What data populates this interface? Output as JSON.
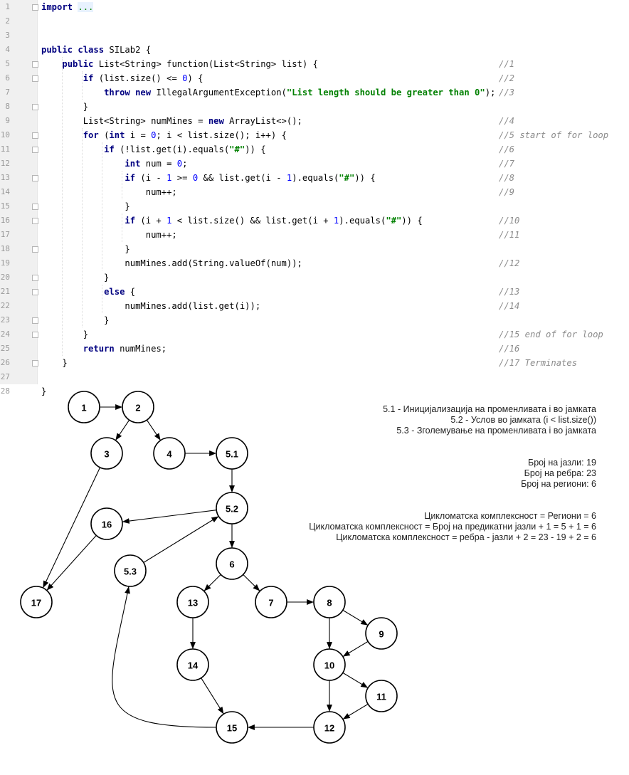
{
  "code": {
    "lines": [
      {
        "n": "1",
        "fold": true,
        "parts": [
          [
            "kw",
            "import "
          ],
          [
            "fold-text",
            "..."
          ]
        ],
        "comment": ""
      },
      {
        "n": "2",
        "fold": false,
        "parts": [],
        "comment": ""
      },
      {
        "n": "3",
        "fold": false,
        "parts": [],
        "comment": ""
      },
      {
        "n": "4",
        "fold": false,
        "parts": [
          [
            "kw",
            "public class "
          ],
          [
            "",
            "SILab2 {"
          ]
        ],
        "comment": ""
      },
      {
        "n": "5",
        "fold": true,
        "parts": [
          [
            "",
            "    "
          ],
          [
            "kw",
            "public "
          ],
          [
            "",
            "List<String> function(List<String> list) {"
          ]
        ],
        "comment": "//1"
      },
      {
        "n": "6",
        "fold": true,
        "parts": [
          [
            "",
            "        "
          ],
          [
            "kw",
            "if "
          ],
          [
            "",
            "(list.size() <= "
          ],
          [
            "num",
            "0"
          ],
          [
            "",
            ") {"
          ]
        ],
        "comment": "//2"
      },
      {
        "n": "7",
        "fold": false,
        "parts": [
          [
            "",
            "            "
          ],
          [
            "kw",
            "throw new "
          ],
          [
            "",
            "IllegalArgumentException("
          ],
          [
            "str",
            "\"List length should be greater than 0\""
          ],
          [
            "",
            ");"
          ]
        ],
        "comment": "//3"
      },
      {
        "n": "8",
        "fold": true,
        "parts": [
          [
            "",
            "        }"
          ]
        ],
        "comment": ""
      },
      {
        "n": "9",
        "fold": false,
        "parts": [
          [
            "",
            "        List<String> numMines = "
          ],
          [
            "kw",
            "new "
          ],
          [
            "",
            "ArrayList<>();"
          ]
        ],
        "comment": "//4"
      },
      {
        "n": "10",
        "fold": true,
        "parts": [
          [
            "",
            "        "
          ],
          [
            "kw",
            "for "
          ],
          [
            "",
            "("
          ],
          [
            "kw",
            "int "
          ],
          [
            "",
            "i = "
          ],
          [
            "num",
            "0"
          ],
          [
            "",
            "; i < list.size(); i++) {"
          ]
        ],
        "comment": "//5 start of for loop"
      },
      {
        "n": "11",
        "fold": true,
        "parts": [
          [
            "",
            "            "
          ],
          [
            "kw",
            "if "
          ],
          [
            "",
            "(!list.get(i).equals("
          ],
          [
            "str",
            "\"#\""
          ],
          [
            "",
            ")) {"
          ]
        ],
        "comment": "//6"
      },
      {
        "n": "12",
        "fold": false,
        "parts": [
          [
            "",
            "                "
          ],
          [
            "kw",
            "int "
          ],
          [
            "",
            "num = "
          ],
          [
            "num",
            "0"
          ],
          [
            "",
            ";"
          ]
        ],
        "comment": "//7"
      },
      {
        "n": "13",
        "fold": true,
        "parts": [
          [
            "",
            "                "
          ],
          [
            "kw",
            "if "
          ],
          [
            "",
            "(i - "
          ],
          [
            "num",
            "1"
          ],
          [
            "",
            " >= "
          ],
          [
            "num",
            "0"
          ],
          [
            "",
            " && list.get(i - "
          ],
          [
            "num",
            "1"
          ],
          [
            "",
            ").equals("
          ],
          [
            "str",
            "\"#\""
          ],
          [
            "",
            ")) {"
          ]
        ],
        "comment": "//8"
      },
      {
        "n": "14",
        "fold": false,
        "parts": [
          [
            "",
            "                    num++;"
          ]
        ],
        "comment": "//9"
      },
      {
        "n": "15",
        "fold": true,
        "parts": [
          [
            "",
            "                }"
          ]
        ],
        "comment": ""
      },
      {
        "n": "16",
        "fold": true,
        "parts": [
          [
            "",
            "                "
          ],
          [
            "kw",
            "if "
          ],
          [
            "",
            "(i + "
          ],
          [
            "num",
            "1"
          ],
          [
            "",
            " < list.size() && list.get(i + "
          ],
          [
            "num",
            "1"
          ],
          [
            "",
            ").equals("
          ],
          [
            "str",
            "\"#\""
          ],
          [
            "",
            ")) {"
          ]
        ],
        "comment": "//10"
      },
      {
        "n": "17",
        "fold": false,
        "parts": [
          [
            "",
            "                    num++;"
          ]
        ],
        "comment": "//11"
      },
      {
        "n": "18",
        "fold": true,
        "parts": [
          [
            "",
            "                }"
          ]
        ],
        "comment": ""
      },
      {
        "n": "19",
        "fold": false,
        "parts": [
          [
            "",
            "                numMines.add(String.valueOf(num));"
          ]
        ],
        "comment": "//12"
      },
      {
        "n": "20",
        "fold": true,
        "parts": [
          [
            "",
            "            }"
          ]
        ],
        "comment": ""
      },
      {
        "n": "21",
        "fold": true,
        "parts": [
          [
            "",
            "            "
          ],
          [
            "kw",
            "else "
          ],
          [
            "",
            "{"
          ]
        ],
        "comment": "//13"
      },
      {
        "n": "22",
        "fold": false,
        "parts": [
          [
            "",
            "                numMines.add(list.get(i));"
          ]
        ],
        "comment": "//14"
      },
      {
        "n": "23",
        "fold": true,
        "parts": [
          [
            "",
            "            }"
          ]
        ],
        "comment": ""
      },
      {
        "n": "24",
        "fold": true,
        "parts": [
          [
            "",
            "        }"
          ]
        ],
        "comment": "//15 end of for loop"
      },
      {
        "n": "25",
        "fold": false,
        "parts": [
          [
            "",
            "        "
          ],
          [
            "kw",
            "return "
          ],
          [
            "",
            "numMines;"
          ]
        ],
        "comment": "//16"
      },
      {
        "n": "26",
        "fold": true,
        "parts": [
          [
            "",
            "    }"
          ]
        ],
        "comment": "//17 Terminates"
      },
      {
        "n": "27",
        "fold": false,
        "parts": [],
        "comment": ""
      },
      {
        "n": "28",
        "fold": false,
        "parts": [
          [
            "",
            "}"
          ]
        ],
        "comment": ""
      }
    ]
  },
  "graph": {
    "nodes": [
      "1",
      "2",
      "3",
      "4",
      "5.1",
      "5.2",
      "16",
      "5.3",
      "6",
      "17",
      "13",
      "7",
      "8",
      "9",
      "14",
      "10",
      "11",
      "15",
      "12"
    ],
    "edges": [
      [
        "1",
        "2"
      ],
      [
        "2",
        "3"
      ],
      [
        "2",
        "4"
      ],
      [
        "4",
        "5.1"
      ],
      [
        "5.1",
        "5.2"
      ],
      [
        "3",
        "17"
      ],
      [
        "5.2",
        "16"
      ],
      [
        "16",
        "17"
      ],
      [
        "5.2",
        "6"
      ],
      [
        "5.3",
        "5.2"
      ],
      [
        "6",
        "13"
      ],
      [
        "6",
        "7"
      ],
      [
        "7",
        "8"
      ],
      [
        "8",
        "9"
      ],
      [
        "8",
        "10"
      ],
      [
        "9",
        "10"
      ],
      [
        "13",
        "14"
      ],
      [
        "14",
        "15"
      ],
      [
        "10",
        "11"
      ],
      [
        "10",
        "12"
      ],
      [
        "11",
        "12"
      ],
      [
        "12",
        "15"
      ],
      [
        "15",
        "5.3"
      ]
    ]
  },
  "notes": {
    "loop_init": "5.1 - Иницијализација на променливата i во јамката",
    "loop_cond": "5.2 - Услов во јамката (i < list.size())",
    "loop_inc": "5.3 - Зголемување на променливата i во јамката",
    "nodes_count": "Број на јазли: 19",
    "edges_count": "Број на ребра: 23",
    "regions_count": "Број на региони: 6",
    "cc_regions": "Цикломатска комплексност = Региони = 6",
    "cc_predicates": "Цикломатска комплексност = Број на предикатни јазли + 1 = 5 + 1 = 6",
    "cc_formula": "Цикломатска комплексност = ребра - јазли + 2 = 23 - 19 + 2 = 6"
  }
}
